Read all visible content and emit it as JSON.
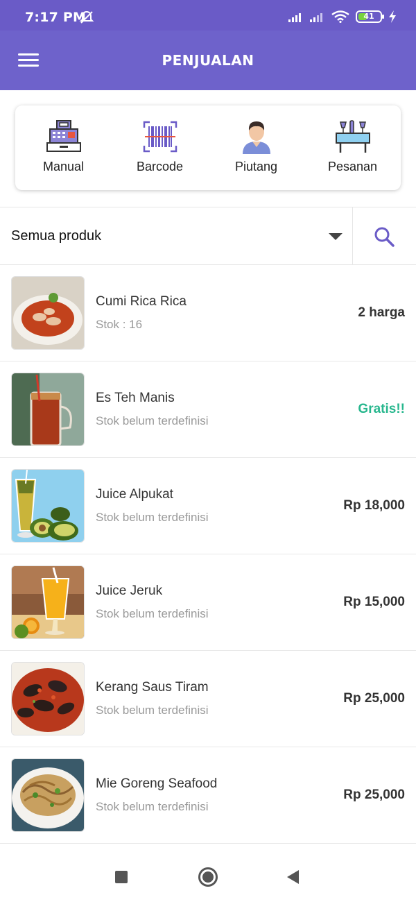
{
  "status_bar": {
    "time": "7:17 PM",
    "battery_level": 41,
    "battery_text": "41",
    "icons": [
      "dnd-off-icon",
      "signal-icon",
      "signal-icon",
      "wifi-icon",
      "battery-icon",
      "charging-icon"
    ]
  },
  "app_bar": {
    "title": "PENJUALAN",
    "menu_icon": "hamburger-menu-icon"
  },
  "modes": [
    {
      "label": "Manual",
      "icon": "cash-register-icon"
    },
    {
      "label": "Barcode",
      "icon": "barcode-icon"
    },
    {
      "label": "Piutang",
      "icon": "person-icon"
    },
    {
      "label": "Pesanan",
      "icon": "restaurant-table-icon"
    }
  ],
  "filter": {
    "selected": "Semua produk",
    "search_icon": "search-icon"
  },
  "products": [
    {
      "name": "Cumi Rica Rica",
      "stock": "Stok : 16",
      "price": "2 harga"
    },
    {
      "name": "Es Teh Manis",
      "stock": "Stok belum terdefinisi",
      "price": "Gratis!!"
    },
    {
      "name": "Juice Alpukat",
      "stock": "Stok belum terdefinisi",
      "price": "Rp 18,000"
    },
    {
      "name": "Juice Jeruk",
      "stock": "Stok belum terdefinisi",
      "price": "Rp 15,000"
    },
    {
      "name": "Kerang Saus Tiram",
      "stock": "Stok belum terdefinisi",
      "price": "Rp 25,000"
    },
    {
      "name": "Mie Goreng Seafood",
      "stock": "Stok belum terdefinisi",
      "price": "Rp 25,000"
    }
  ],
  "colors": {
    "primary": "#6e62cb",
    "status_bar": "#6a5bc7",
    "accent_icon": "#6a5bc7",
    "free_price": "#28b78e"
  },
  "nav": {
    "icons": [
      "recent-apps-icon",
      "home-icon",
      "back-icon"
    ]
  }
}
